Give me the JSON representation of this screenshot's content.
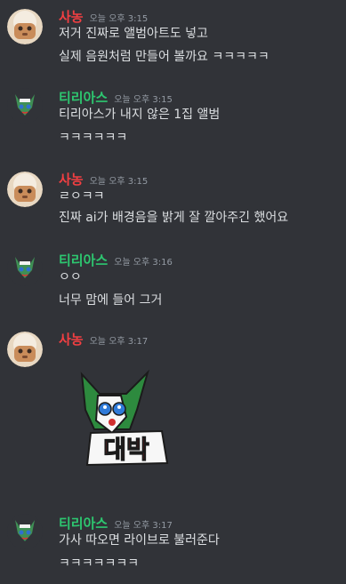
{
  "users": {
    "sanong": {
      "name": "사농",
      "color": "#f23f42"
    },
    "tirias": {
      "name": "티리아스",
      "color": "#2dc770"
    }
  },
  "messages": [
    {
      "author": "사농",
      "time": "오늘 오후 3:15",
      "lines": [
        "저거 진짜로 앨범아트도 넣고",
        "실제 음원처럼 만들어 볼까요 ㅋㅋㅋㅋㅋ"
      ]
    },
    {
      "author": "티리아스",
      "time": "오늘 오후 3:15",
      "lines": [
        "티리아스가 내지 않은 1집 앨범",
        "ㅋㅋㅋㅋㅋㅋ"
      ]
    },
    {
      "author": "사농",
      "time": "오늘 오후 3:15",
      "lines": [
        "ㄹㅇㅋㅋ",
        "진짜 ai가 배경음을 밝게 잘 깔아주긴 했어요"
      ]
    },
    {
      "author": "티리아스",
      "time": "오늘 오후 3:16",
      "lines": [
        "ㅇㅇ",
        "너무 맘에 들어 그거"
      ]
    },
    {
      "author": "사농",
      "time": "오늘 오후 3:17",
      "sticker_text": "대박"
    },
    {
      "author": "티리아스",
      "time": "오늘 오후 3:17",
      "lines": [
        "가사 따오면 라이브로 불러준다",
        "ㅋㅋㅋㅋㅋㅋㅋ"
      ]
    }
  ]
}
